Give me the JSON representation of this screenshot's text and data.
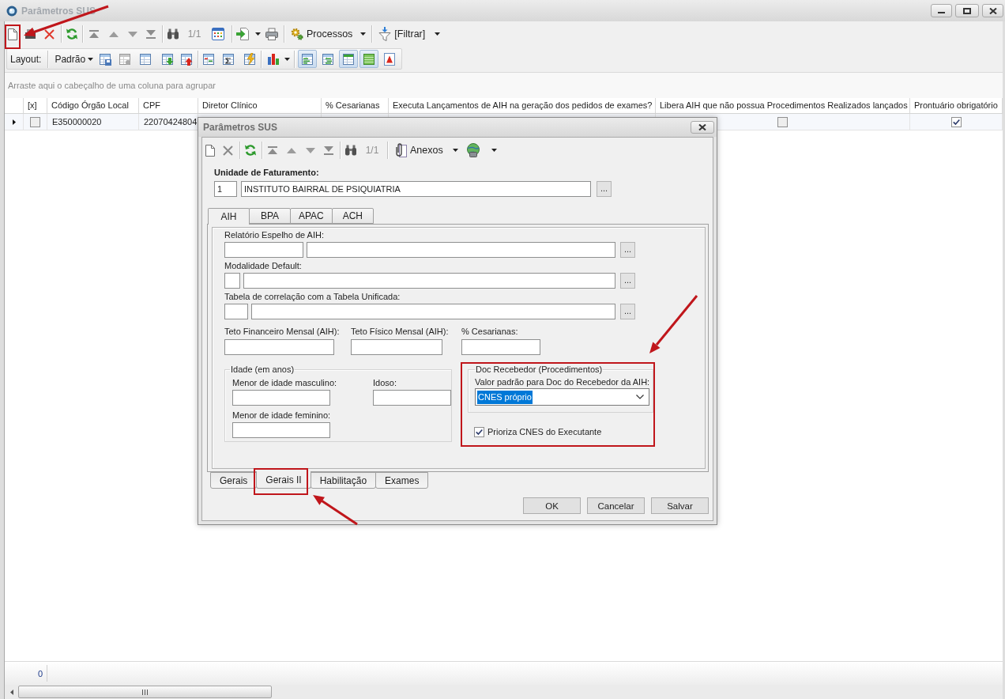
{
  "window": {
    "title": "Parâmetros SUS"
  },
  "toolbar": {
    "record_counter": "1/1",
    "processes": "Processos",
    "filter": "[Filtrar]"
  },
  "layout_bar": {
    "label": "Layout:",
    "preset": "Padrão",
    "view_toggles": [
      {
        "selected": true
      },
      {
        "selected": false
      },
      {
        "selected": true
      },
      {
        "selected": true
      },
      {
        "selected": false
      }
    ]
  },
  "group_panel": {
    "hint": "Arraste aqui o cabeçalho de uma coluna para agrupar"
  },
  "grid": {
    "columns": [
      "[x]",
      "Código Órgão Local",
      "CPF",
      "Diretor Clínico",
      "% Cesarianas",
      "Executa Lançamentos de AIH na geração dos pedidos de exames?",
      "Libera AIH que não possua Procedimentos Realizados lançados",
      "Prontuário obrigatório"
    ],
    "rows": [
      {
        "current": true,
        "cells": [
          {
            "kind": "checkbox",
            "checked": false
          },
          {
            "kind": "text",
            "text": "E350000020"
          },
          {
            "kind": "text",
            "text": "22070424804"
          },
          {
            "kind": "covered"
          },
          {
            "kind": "covered"
          },
          {
            "kind": "covered"
          },
          {
            "kind": "checkbox",
            "checked": false
          },
          {
            "kind": "checkbox",
            "checked": true
          }
        ]
      }
    ]
  },
  "footer": {
    "count": "0"
  },
  "dialog": {
    "title": "Parâmetros SUS",
    "toolbar": {
      "record_counter": "1/1",
      "attachments": "Anexos"
    },
    "billing_unit": {
      "label": "Unidade de Faturamento:",
      "code": "1",
      "name": "INSTITUTO BAIRRAL DE PSIQUIATRIA",
      "lookup": "..."
    },
    "section_tabs": [
      {
        "label": "AIH",
        "selected": true
      },
      {
        "label": "BPA",
        "selected": false
      },
      {
        "label": "APAC",
        "selected": false
      },
      {
        "label": "ACH",
        "selected": false
      }
    ],
    "lookups": [
      {
        "label": "Relatório Espelho de AIH:",
        "lookup": "..."
      },
      {
        "label": "Modalidade Default:",
        "lookup": "..."
      },
      {
        "label": "Tabela de correlação com a Tabela Unificada:",
        "lookup": "..."
      }
    ],
    "limits": [
      {
        "label": "Teto Financeiro Mensal (AIH):"
      },
      {
        "label": "Teto Físico Mensal (AIH):"
      },
      {
        "label": "% Cesarianas:"
      }
    ],
    "age_group": {
      "title": "Idade (em anos)",
      "fields": [
        {
          "label": "Menor de idade masculino:"
        },
        {
          "label": "Idoso:"
        },
        {
          "label": "Menor de idade feminino:"
        }
      ]
    },
    "doc_group": {
      "title": "Doc Recebedor (Procedimentos)",
      "select": {
        "label": "Valor padrão para Doc do Recebedor da AIH:",
        "value": "CNES próprio",
        "focused": true
      }
    },
    "prioritize": {
      "label": "Prioriza CNES do Executante",
      "checked": true
    },
    "page_tabs": [
      {
        "label": "Gerais",
        "selected": false
      },
      {
        "label": "Gerais II",
        "selected": true
      },
      {
        "label": "Habilitação",
        "selected": false
      },
      {
        "label": "Exames",
        "selected": false
      }
    ],
    "buttons": [
      "OK",
      "Cancelar",
      "Salvar"
    ]
  }
}
